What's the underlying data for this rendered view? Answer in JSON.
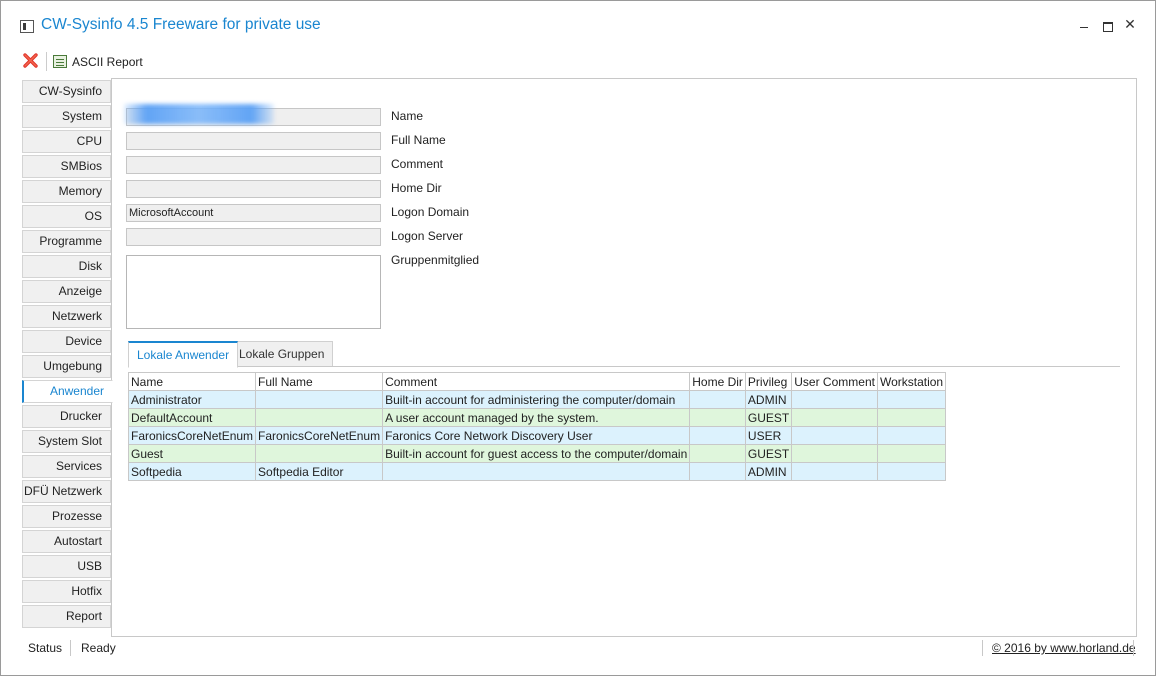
{
  "window": {
    "title": "CW-Sysinfo 4.5 Freeware for private use"
  },
  "toolbar": {
    "close_icon": "red-x-icon",
    "report_label": "ASCII Report",
    "report_icon": "report-icon"
  },
  "sidebar": {
    "active": "Anwender",
    "items": [
      {
        "label": "CW-Sysinfo"
      },
      {
        "label": "System"
      },
      {
        "label": "CPU"
      },
      {
        "label": "SMBios"
      },
      {
        "label": "Memory"
      },
      {
        "label": "OS"
      },
      {
        "label": "Programme"
      },
      {
        "label": "Disk"
      },
      {
        "label": "Anzeige"
      },
      {
        "label": "Netzwerk"
      },
      {
        "label": "Device"
      },
      {
        "label": "Umgebung"
      },
      {
        "label": "Anwender"
      },
      {
        "label": "Drucker"
      },
      {
        "label": "System Slot"
      },
      {
        "label": "Services"
      },
      {
        "label": "DFÜ Netzwerk"
      },
      {
        "label": "Prozesse"
      },
      {
        "label": "Autostart"
      },
      {
        "label": "USB"
      },
      {
        "label": "Hotfix"
      },
      {
        "label": "Report"
      }
    ]
  },
  "user_info": {
    "fields": [
      {
        "label": "Name",
        "value": ""
      },
      {
        "label": "Full Name",
        "value": ""
      },
      {
        "label": "Comment",
        "value": ""
      },
      {
        "label": "Home Dir",
        "value": ""
      },
      {
        "label": "Logon Domain",
        "value": "MicrosoftAccount"
      },
      {
        "label": "Logon Server",
        "value": ""
      }
    ],
    "groups_label": "Gruppenmitglied"
  },
  "tabs": [
    {
      "label": "Lokale Anwender",
      "active": true
    },
    {
      "label": "Lokale Gruppen",
      "active": false
    }
  ],
  "table": {
    "columns": [
      "Name",
      "Full Name",
      "Comment",
      "Home Dir",
      "Privileg",
      "User Comment",
      "Workstation"
    ],
    "rows": [
      {
        "cells": [
          "Administrator",
          "",
          "Built-in account for administering the computer/domain",
          "",
          "ADMIN",
          "",
          ""
        ],
        "color": "blue"
      },
      {
        "cells": [
          "DefaultAccount",
          "",
          "A user account managed by the system.",
          "",
          "GUEST",
          "",
          ""
        ],
        "color": "green"
      },
      {
        "cells": [
          "FaronicsCoreNetEnum",
          "FaronicsCoreNetEnum",
          "Faronics Core Network Discovery User",
          "",
          "USER",
          "",
          ""
        ],
        "color": "blue"
      },
      {
        "cells": [
          "Guest",
          "",
          "Built-in account for guest access to the computer/domain",
          "",
          "GUEST",
          "",
          ""
        ],
        "color": "green"
      },
      {
        "cells": [
          "Softpedia",
          "Softpedia Editor",
          "",
          "",
          "ADMIN",
          "",
          ""
        ],
        "color": "blue"
      }
    ]
  },
  "status": {
    "label": "Status",
    "value": "Ready",
    "copyright": "© 2016 by www.horland.de"
  },
  "colors": {
    "accent": "#1a86d0",
    "row_blue": "#dcf2fd",
    "row_green": "#dff6dc"
  }
}
